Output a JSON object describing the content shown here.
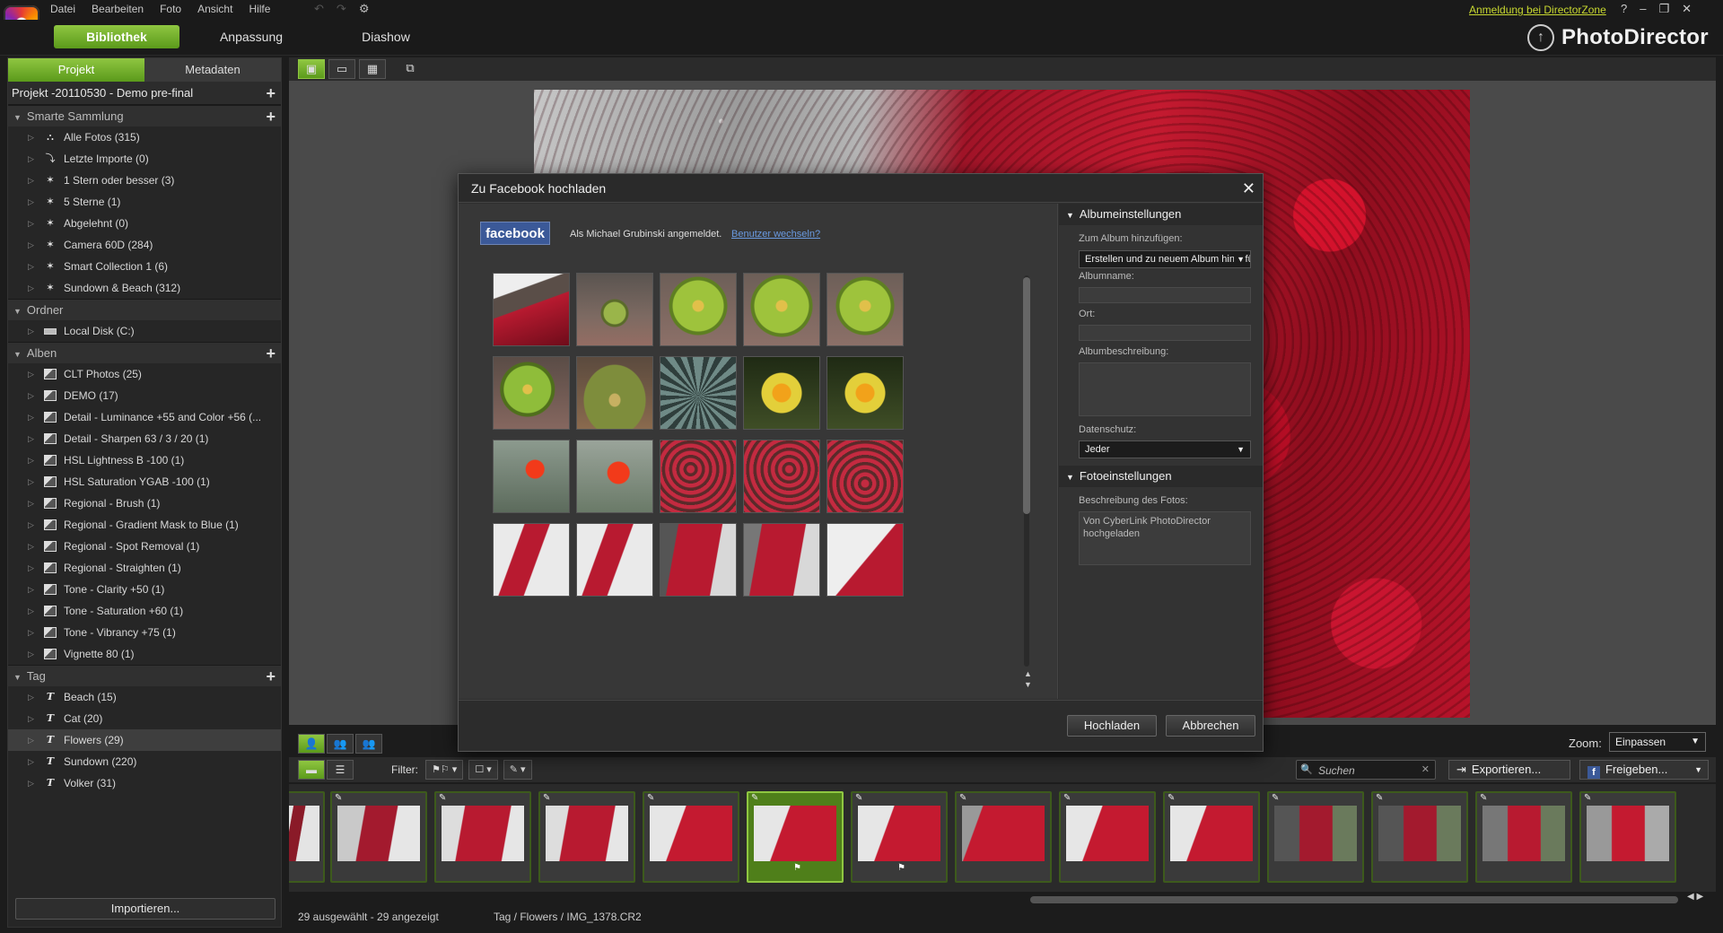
{
  "menubar": {
    "items": [
      "Datei",
      "Bearbeiten",
      "Foto",
      "Ansicht",
      "Hilfe"
    ],
    "directorzone_link": "Anmeldung bei DirectorZone",
    "help": "?",
    "minimize": "–",
    "restore": "❐",
    "close": "✕"
  },
  "modes": {
    "library": "Bibliothek",
    "adjust": "Anpassung",
    "slideshow": "Diashow",
    "brand": "PhotoDirector"
  },
  "left": {
    "tabs": [
      "Projekt",
      "Metadaten"
    ],
    "project": "Projekt -20110530 - Demo pre-final",
    "smart_head": "Smarte Sammlung",
    "smart": [
      {
        "label": "Alle Fotos (315)",
        "icon": "people-icon"
      },
      {
        "label": "Letzte Importe (0)",
        "icon": "import-icon"
      },
      {
        "label": "1 Stern oder besser (3)",
        "icon": "smart-icon"
      },
      {
        "label": "5 Sterne (1)",
        "icon": "smart-icon"
      },
      {
        "label": "Abgelehnt (0)",
        "icon": "smart-icon"
      },
      {
        "label": "Camera 60D (284)",
        "icon": "smart-icon"
      },
      {
        "label": "Smart Collection 1 (6)",
        "icon": "smart-icon"
      },
      {
        "label": "Sundown & Beach (312)",
        "icon": "smart-icon"
      }
    ],
    "folder_head": "Ordner",
    "folders": [
      {
        "label": "Local Disk (C:)"
      }
    ],
    "album_head": "Alben",
    "albums": [
      {
        "label": "CLT Photos (25)"
      },
      {
        "label": "DEMO (17)"
      },
      {
        "label": "Detail - Luminance +55 and Color +56 (..."
      },
      {
        "label": "Detail - Sharpen 63 / 3 / 20 (1)"
      },
      {
        "label": "HSL Lightness B -100 (1)"
      },
      {
        "label": "HSL Saturation YGAB -100 (1)"
      },
      {
        "label": "Regional - Brush (1)"
      },
      {
        "label": "Regional - Gradient Mask to Blue (1)"
      },
      {
        "label": "Regional - Spot Removal (1)"
      },
      {
        "label": "Regional - Straighten (1)"
      },
      {
        "label": "Tone - Clarity +50 (1)"
      },
      {
        "label": "Tone - Saturation +60 (1)"
      },
      {
        "label": "Tone - Vibrancy +75 (1)"
      },
      {
        "label": "Vignette 80 (1)"
      }
    ],
    "tag_head": "Tag",
    "tags": [
      {
        "label": "Beach (15)"
      },
      {
        "label": "Cat (20)"
      },
      {
        "label": "Flowers (29)",
        "selected": true
      },
      {
        "label": "Sundown (220)"
      },
      {
        "label": "Volker (31)"
      }
    ],
    "import": "Importieren..."
  },
  "zoom": {
    "label": "Zoom:",
    "value": "Einpassen"
  },
  "film": {
    "filter": "Filter:",
    "search_placeholder": "Suchen",
    "export": "Exportieren...",
    "share": "Freigeben..."
  },
  "status": {
    "selection": "29 ausgewählt - 29 angezeigt",
    "path": "Tag / Flowers / IMG_1378.CR2"
  },
  "dialog": {
    "title": "Zu Facebook hochladen",
    "facebook": "facebook",
    "user": "Als Michael Grubinski angemeldet.",
    "switch_user": "Benutzer wechseln?",
    "album_head": "Albumeinstellungen",
    "add_to_album_label": "Zum Album hinzufügen:",
    "add_to_album_value": "Erstellen und zu neuem Album hinzufügen",
    "album_name_label": "Albumname:",
    "location_label": "Ort:",
    "album_desc_label": "Albumbeschreibung:",
    "privacy_label": "Datenschutz:",
    "privacy_value": "Jeder",
    "photo_head": "Fotoeinstellungen",
    "photo_desc_label": "Beschreibung des Fotos:",
    "photo_desc_value": "Von CyberLink PhotoDirector hochgeladen",
    "upload": "Hochladen",
    "cancel": "Abbrechen"
  },
  "colors": {
    "accent_green": "#7ab32e",
    "facebook_blue": "#3b5998",
    "link_yellow": "#c8d830"
  }
}
